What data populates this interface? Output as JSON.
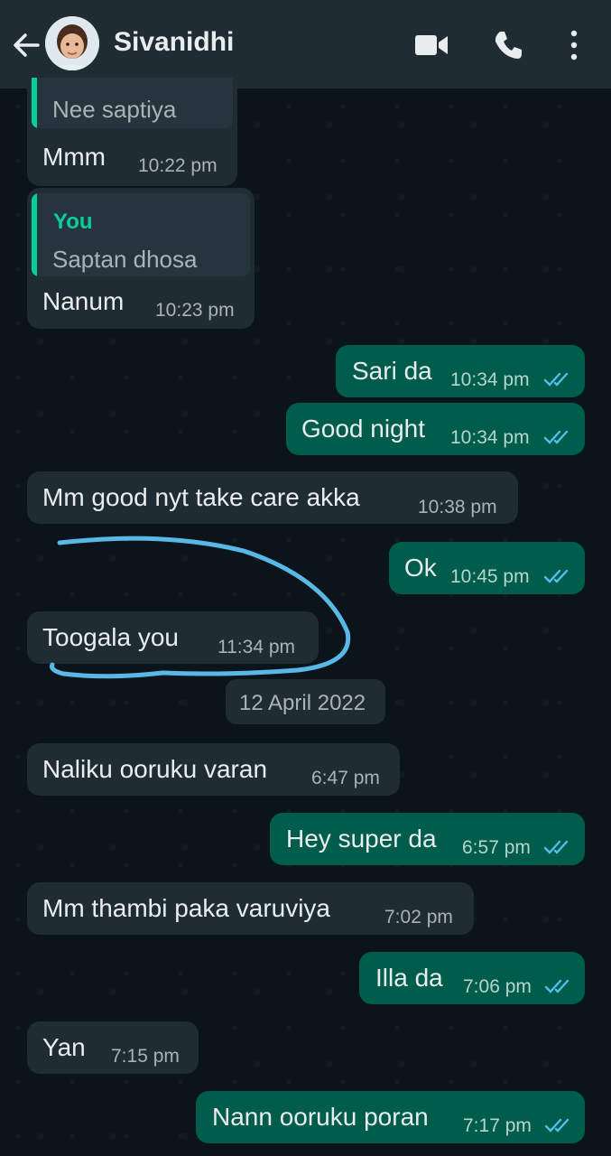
{
  "header": {
    "contact_name": "Sivanidhi",
    "icons": [
      "back-arrow-icon",
      "video-call-icon",
      "phone-icon",
      "more-vert-icon"
    ]
  },
  "messages": [
    {
      "direction": "in",
      "quote_text": "Nee saptiya",
      "text": "Mmm",
      "time": "10:22 pm"
    },
    {
      "direction": "in",
      "quote_author": "You",
      "quote_text": "Saptan dhosa",
      "text": "Nanum",
      "time": "10:23 pm"
    },
    {
      "direction": "out",
      "text": "Sari da",
      "time": "10:34 pm",
      "status": "read"
    },
    {
      "direction": "out",
      "text": "Good night",
      "time": "10:34 pm",
      "status": "read"
    },
    {
      "direction": "in",
      "text": "Mm good nyt take care akka",
      "time": "10:38 pm"
    },
    {
      "direction": "out",
      "text": "Ok",
      "time": "10:45 pm",
      "status": "read"
    },
    {
      "direction": "in",
      "text": "Toogala you",
      "time": "11:34 pm"
    },
    {
      "direction": "in",
      "text": "Naliku ooruku varan",
      "time": "6:47 pm"
    },
    {
      "direction": "out",
      "text": "Hey super da",
      "time": "6:57 pm",
      "status": "read"
    },
    {
      "direction": "in",
      "text": "Mm thambi paka varuviya",
      "time": "7:02 pm"
    },
    {
      "direction": "out",
      "text": "Illa da",
      "time": "7:06 pm",
      "status": "read"
    },
    {
      "direction": "in",
      "text": "Yan",
      "time": "7:15 pm"
    },
    {
      "direction": "out",
      "text": "Nann ooruku poran",
      "time": "7:17 pm",
      "status": "read"
    }
  ],
  "date_divider": "12 April 2022",
  "colors": {
    "background": "#0b141a",
    "header": "#1f2c34",
    "incoming_bubble": "#1f2c34",
    "outgoing_bubble": "#005c4b",
    "read_ticks": "#53bdeb",
    "quote_accent": "#06cf9c",
    "annotation_stroke": "#5ab8e6"
  }
}
